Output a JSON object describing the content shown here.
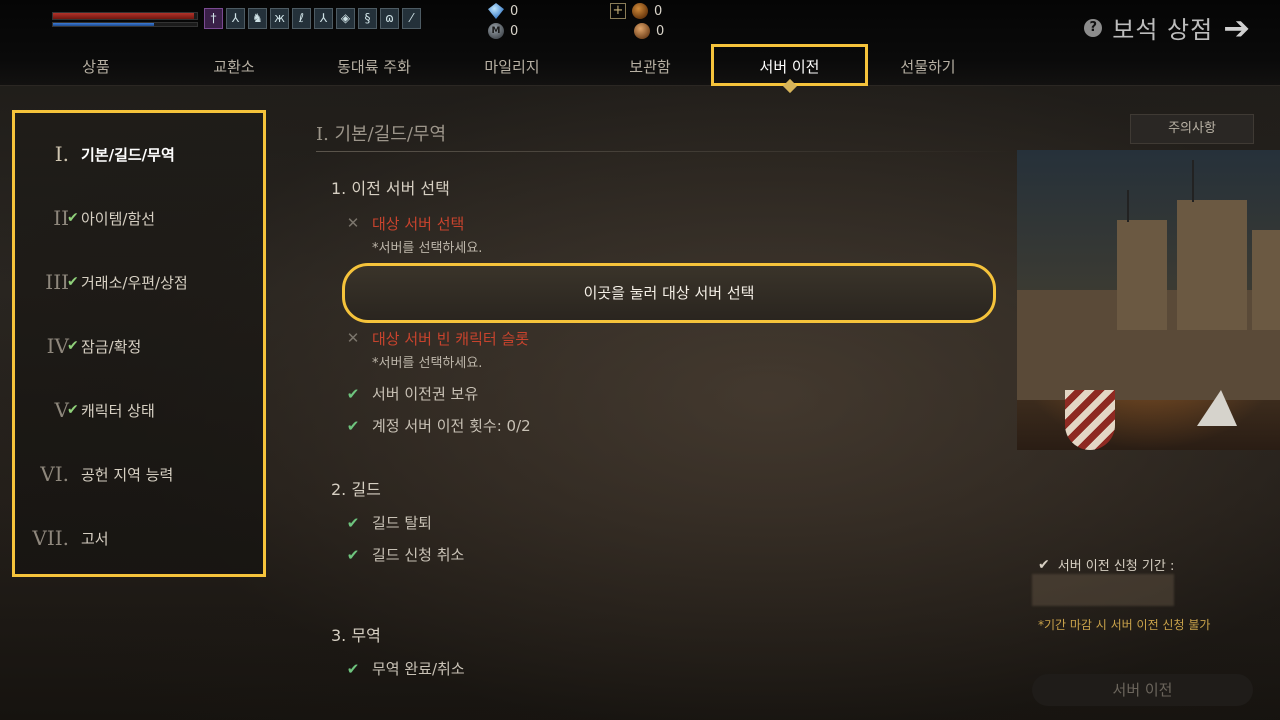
{
  "header": {
    "status": {
      "hp_fraction": 0.98,
      "mp_fraction": 0.7
    },
    "buffs": [
      "sword-buff-icon",
      "stance-icon",
      "beast-icon",
      "wings-icon",
      "feather-icon",
      "stance-icon-2",
      "shield-icon",
      "scroll-icon",
      "horn-icon",
      "leaf-icon"
    ],
    "currencies": [
      {
        "icon": "blue-gem-icon",
        "value": "0"
      },
      {
        "icon": "m-coin-icon",
        "value": "0"
      },
      {
        "icon": "gold-coin-icon",
        "value": "0"
      },
      {
        "icon": "bronze-coin-icon",
        "value": "0"
      }
    ],
    "shop_title": "보석 상점",
    "tabs": [
      "상품",
      "교환소",
      "동대륙 주화",
      "마일리지",
      "보관함",
      "서버 이전",
      "선물하기"
    ],
    "active_tab_index": 5
  },
  "sidebar": {
    "items": [
      {
        "roman": "I.",
        "label": "기본/길드/무역",
        "checked": false
      },
      {
        "roman": "II",
        "label": "아이템/함선",
        "checked": true
      },
      {
        "roman": "III",
        "label": "거래소/우편/상점",
        "checked": true
      },
      {
        "roman": "IV",
        "label": "잠금/확정",
        "checked": true
      },
      {
        "roman": "V",
        "label": "캐릭터 상태",
        "checked": true
      },
      {
        "roman": "VI.",
        "label": "공헌 지역 능력",
        "checked": false
      },
      {
        "roman": "VII.",
        "label": "고서",
        "checked": false
      }
    ]
  },
  "main": {
    "section_title": "I. 기본/길드/무역",
    "notice_button": "주의사항",
    "groups": [
      {
        "title": "1. 이전 서버 선택"
      },
      {
        "title": "2. 길드"
      },
      {
        "title": "3. 무역"
      }
    ],
    "requirements": {
      "target_server": {
        "label": "대상 서버 선택",
        "sub": "*서버를 선택하세요."
      },
      "select_button": "이곳을 눌러 대상 서버 선택",
      "empty_slot": {
        "label": "대상 서버 빈 캐릭터 슬롯",
        "sub": "*서버를 선택하세요."
      },
      "ticket": "서버 이전권 보유",
      "account_count": "계정 서버 이전 횟수: 0/2",
      "guild_leave": "길드 탈퇴",
      "guild_cancel": "길드 신청 취소",
      "trade_done": "무역 완료/취소"
    }
  },
  "right_panel": {
    "period_label": "서버 이전 신청 기간 :",
    "period_note": "*기간 마감 시 서버 이전 신청 불가",
    "transfer_button": "서버 이전"
  },
  "colors": {
    "highlight": "#f5c33b",
    "error": "#c7432d",
    "check": "#6ec47e",
    "note": "#c9a24a"
  }
}
